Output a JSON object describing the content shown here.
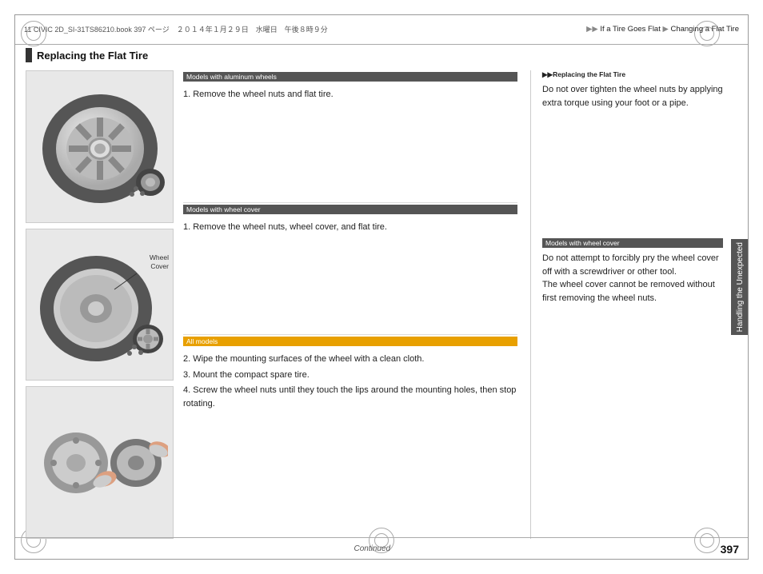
{
  "header": {
    "left_text": "11 CIVIC 2D_SI-31TS86210.book  397 ページ　２０１４年１月２９日　水曜日　午後８時９分",
    "right_text": "If a Tire Goes Flat",
    "right_sub": "Changing a Flat Tire"
  },
  "section": {
    "title": "Replacing the Flat Tire"
  },
  "note_header1": "▶▶Replacing the Flat Tire",
  "note_text1": "Do not over tighten the wheel nuts by applying extra torque using your foot or a pipe.",
  "label_aluminum": "Models with aluminum wheels",
  "step1_aluminum": "1. Remove the wheel nuts and flat tire.",
  "label_wheel_cover": "Models with wheel cover",
  "wheel_cover_label": "Wheel\nCover",
  "step1_wheel_cover": "1. Remove the wheel nuts, wheel cover, and flat tire.",
  "note_header_wheel_cover": "Models with wheel cover",
  "note_text_wheel_cover": "Do not attempt to forcibly pry the wheel cover off with a screwdriver or other tool.\nThe wheel cover cannot be removed without first removing the wheel nuts.",
  "label_all_models": "All models",
  "step2": "2. Wipe the mounting surfaces of the wheel with a clean cloth.",
  "step3": "3. Mount the compact spare tire.",
  "step4": "4. Screw the wheel nuts until they touch the lips around the mounting holes, then stop rotating.",
  "footer": {
    "continued": "Continued",
    "page_number": "397"
  },
  "side_tab_text": "Handling the Unexpected"
}
